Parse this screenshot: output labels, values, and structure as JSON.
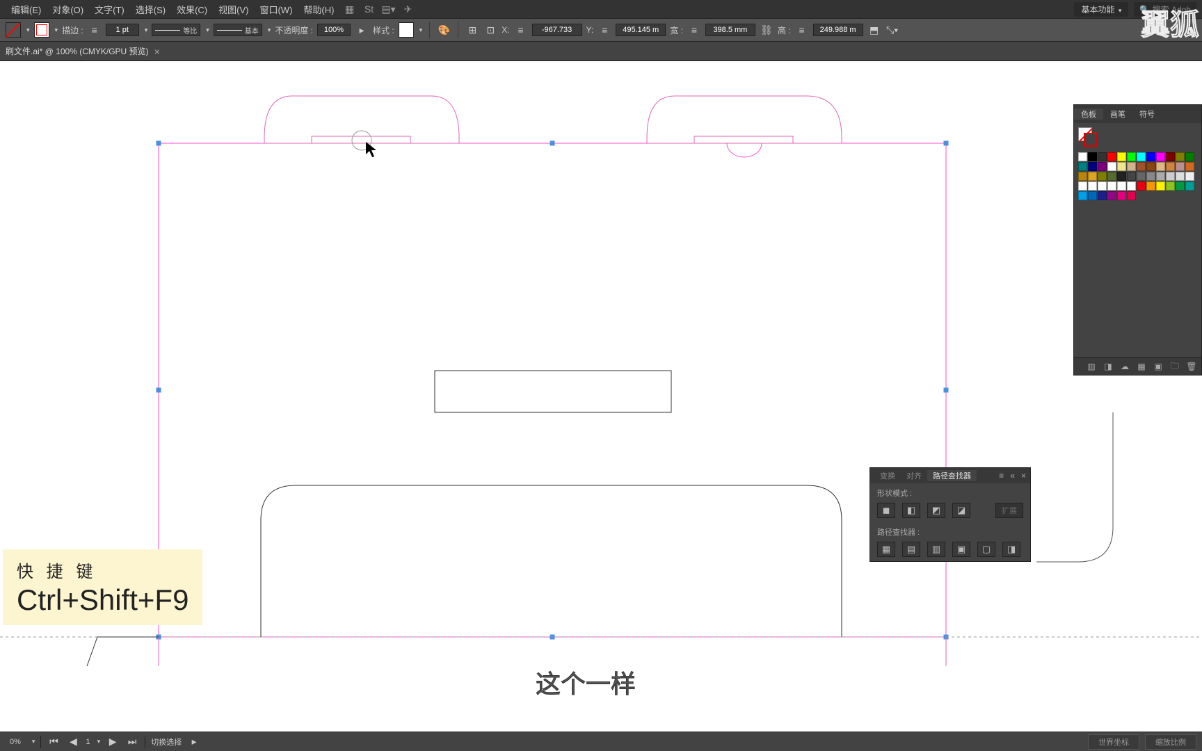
{
  "menu": {
    "edit": "编辑(E)",
    "object": "对象(O)",
    "text": "文字(T)",
    "select": "选择(S)",
    "effect": "效果(C)",
    "view": "视图(V)",
    "window": "窗口(W)",
    "help": "帮助(H)"
  },
  "workspace": {
    "label": "基本功能",
    "search_placeholder": "搜索 Adob"
  },
  "control": {
    "stroke_label": "描边 :",
    "stroke_weight": "1 pt",
    "profile_label": "等比",
    "brush_label": "基本",
    "opacity_label": "不透明度 :",
    "opacity": "100%",
    "style_label": "样式 :",
    "x_label": "X:",
    "x": "-967.733",
    "y_label": "Y:",
    "y": "495.145 m",
    "w_label": "宽 :",
    "w": "398.5 mm",
    "h_label": "高 :",
    "h": "249.988 m"
  },
  "tab": {
    "title": "刷文件.ai* @ 100% (CMYK/GPU 预览)"
  },
  "swatches": {
    "tabs": [
      "色板",
      "画笔",
      "符号"
    ],
    "colors": [
      "#ffffff",
      "#000000",
      "#333333",
      "#ff0000",
      "#ffff00",
      "#00ff00",
      "#00ffff",
      "#0000ff",
      "#ff00ff",
      "#7f0000",
      "#7f7f00",
      "#007f00",
      "#007f7f",
      "#00007f",
      "#7f007f",
      "#ffffff",
      "#f0e68c",
      "#d2b48c",
      "#a0522d",
      "#8b4513",
      "#deb887",
      "#cd853f",
      "#bc8f8f",
      "#d2691e",
      "#b8860b",
      "#daa520",
      "#808000",
      "#556b2f",
      "#222222",
      "#444444",
      "#666666",
      "#888888",
      "#aaaaaa",
      "#cccccc",
      "#dddddd",
      "#eeeeee",
      "#ffffff",
      "#ffffff",
      "#ffffff",
      "#ffffff",
      "#ffffff",
      "#ffffff",
      "#e60012",
      "#f39800",
      "#fff100",
      "#8fc31f",
      "#009944",
      "#009e96",
      "#00a0e9",
      "#0068b7",
      "#1d2088",
      "#920783",
      "#e4007f",
      "#e5004f"
    ]
  },
  "pathfinder": {
    "tabs": [
      "变换",
      "对齐",
      "路径查找器"
    ],
    "shape_modes_label": "形状模式 :",
    "expand_label": "扩展",
    "pathfinders_label": "路径查找器 :"
  },
  "shortcut": {
    "title": "快 捷 键",
    "keys": "Ctrl+Shift+F9"
  },
  "subtitle": "这个一样",
  "status": {
    "zoom": "0%",
    "mode": "切换选择",
    "coord": "世界坐标",
    "scale": "缩放比例"
  },
  "watermark": "翼狐"
}
